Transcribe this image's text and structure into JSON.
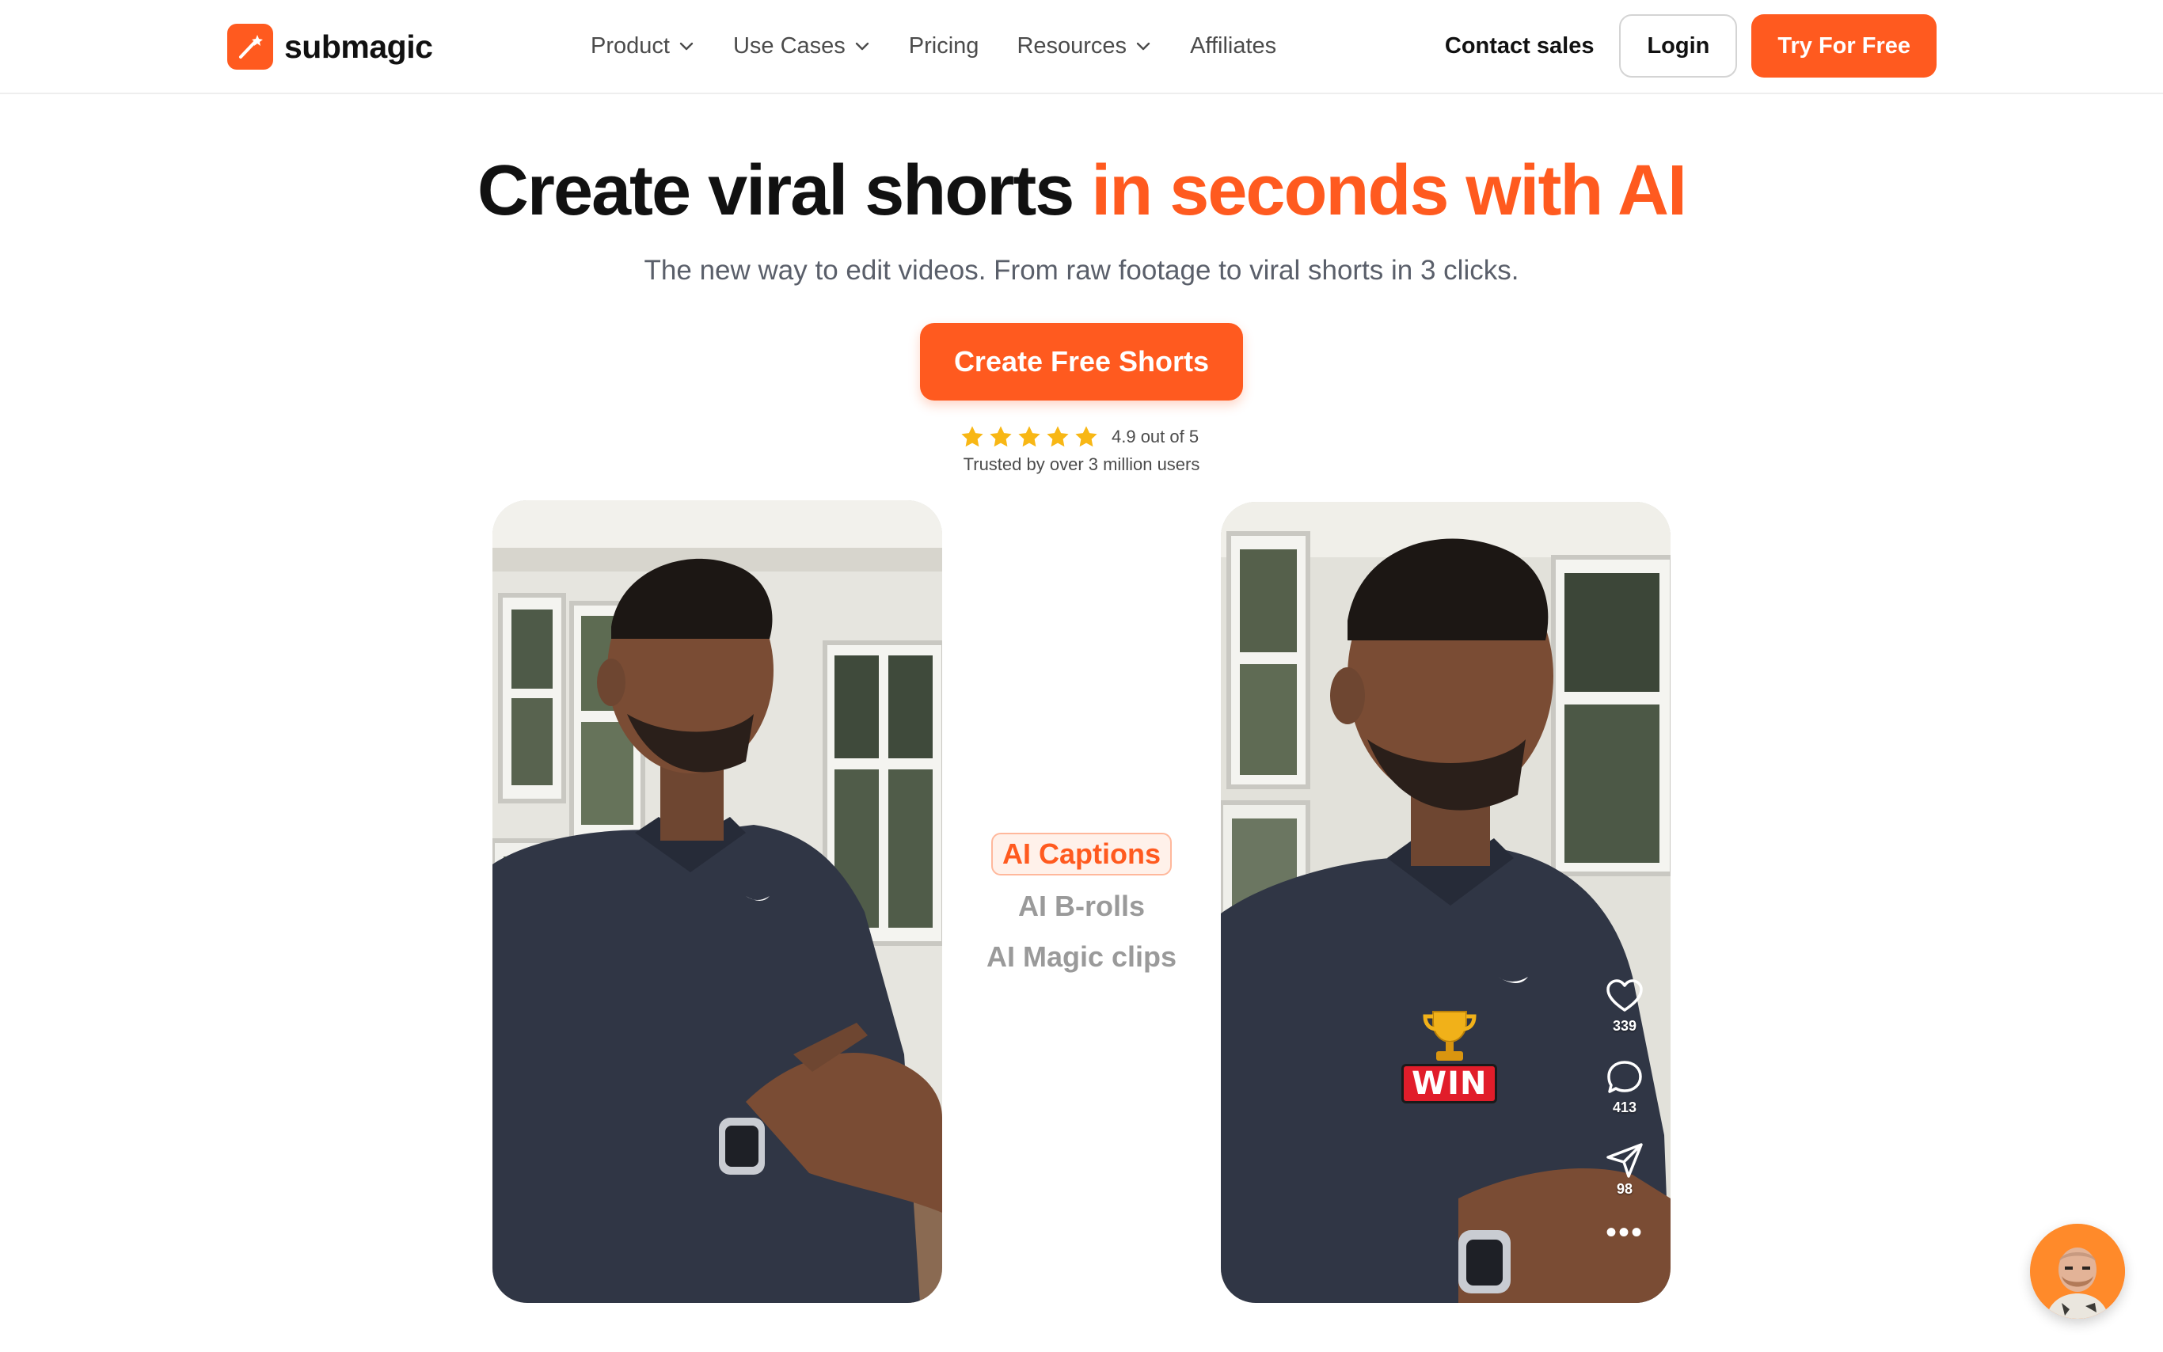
{
  "brand": {
    "name": "submagic",
    "accent": "#ff5a1f"
  },
  "nav": {
    "items": [
      {
        "label": "Product",
        "dropdown": true
      },
      {
        "label": "Use Cases",
        "dropdown": true
      },
      {
        "label": "Pricing",
        "dropdown": false
      },
      {
        "label": "Resources",
        "dropdown": true
      },
      {
        "label": "Affiliates",
        "dropdown": false
      }
    ],
    "contact": "Contact sales",
    "login": "Login",
    "try": "Try For Free"
  },
  "hero": {
    "title_main": "Create viral shorts ",
    "title_accent": "in seconds with AI",
    "subtitle": "The new way to edit videos. From raw footage to viral shorts in 3 clicks.",
    "cta": "Create Free Shorts",
    "rating_text": "4.9 out of 5",
    "rating_value": 4.9,
    "rating_max": 5,
    "trusted": "Trusted by over 3 million users"
  },
  "features": {
    "items": [
      "AI Captions",
      "AI B-rolls",
      "AI Magic clips"
    ],
    "active": "AI Captions"
  },
  "video_after": {
    "badge": "WIN",
    "likes": "339",
    "comments": "413",
    "shares": "98"
  }
}
